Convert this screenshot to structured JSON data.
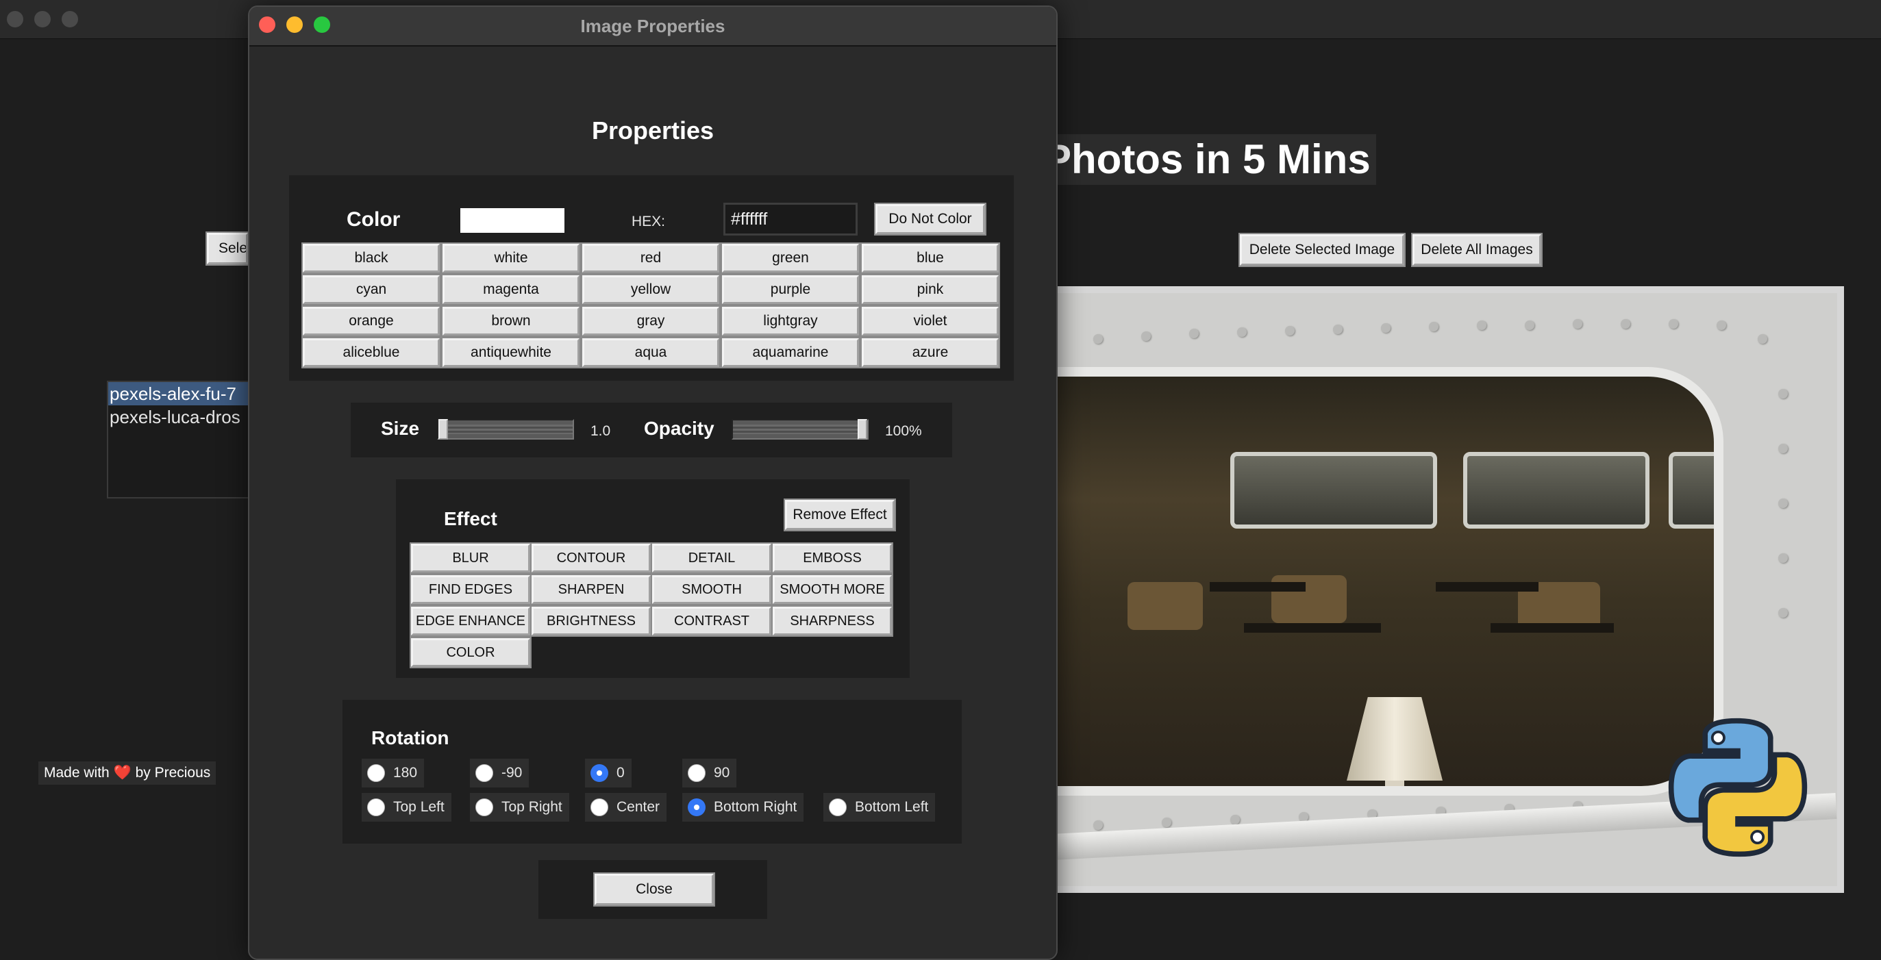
{
  "background_app": {
    "heading": "Photos in 5 Mins",
    "select_button_label": "Sele",
    "delete_selected_label": "Delete Selected Image",
    "delete_all_label": "Delete All Images",
    "image_list": [
      "pexels-alex-fu-7",
      "pexels-luca-dros"
    ],
    "footer": {
      "prefix": "Made with",
      "heart": "❤️",
      "suffix": "by Precious"
    }
  },
  "dialog": {
    "title": "Image Properties",
    "heading": "Properties",
    "color": {
      "label": "Color",
      "swatch_color": "#ffffff",
      "hex_label": "HEX:",
      "hex_value": "#ffffff",
      "do_not_color_label": "Do Not Color",
      "options": [
        "black",
        "white",
        "red",
        "green",
        "blue",
        "cyan",
        "magenta",
        "yellow",
        "purple",
        "pink",
        "orange",
        "brown",
        "gray",
        "lightgray",
        "violet",
        "aliceblue",
        "antiquewhite",
        "aqua",
        "aquamarine",
        "azure"
      ]
    },
    "size": {
      "label": "Size",
      "value_text": "1.0",
      "value_fraction": 0.0
    },
    "opacity": {
      "label": "Opacity",
      "value_text": "100%",
      "value_fraction": 1.0
    },
    "effect": {
      "label": "Effect",
      "remove_label": "Remove Effect",
      "options": [
        "BLUR",
        "CONTOUR",
        "DETAIL",
        "EMBOSS",
        "FIND EDGES",
        "SHARPEN",
        "SMOOTH",
        "SMOOTH MORE",
        "EDGE ENHANCE",
        "BRIGHTNESS",
        "CONTRAST",
        "SHARPNESS",
        "COLOR"
      ]
    },
    "rotation": {
      "label": "Rotation",
      "angles": [
        "180",
        "-90",
        "0",
        "90"
      ],
      "selected_angle": "0",
      "anchors": [
        "Top Left",
        "Top Right",
        "Center",
        "Bottom Right",
        "Bottom Left"
      ],
      "selected_anchor": "Bottom Right"
    },
    "close_label": "Close"
  },
  "colors": {
    "accent": "#3478f6",
    "close_light": "#ff5f57",
    "min_light": "#febc2e",
    "max_light": "#28c840",
    "selection": "#3d5a80"
  }
}
